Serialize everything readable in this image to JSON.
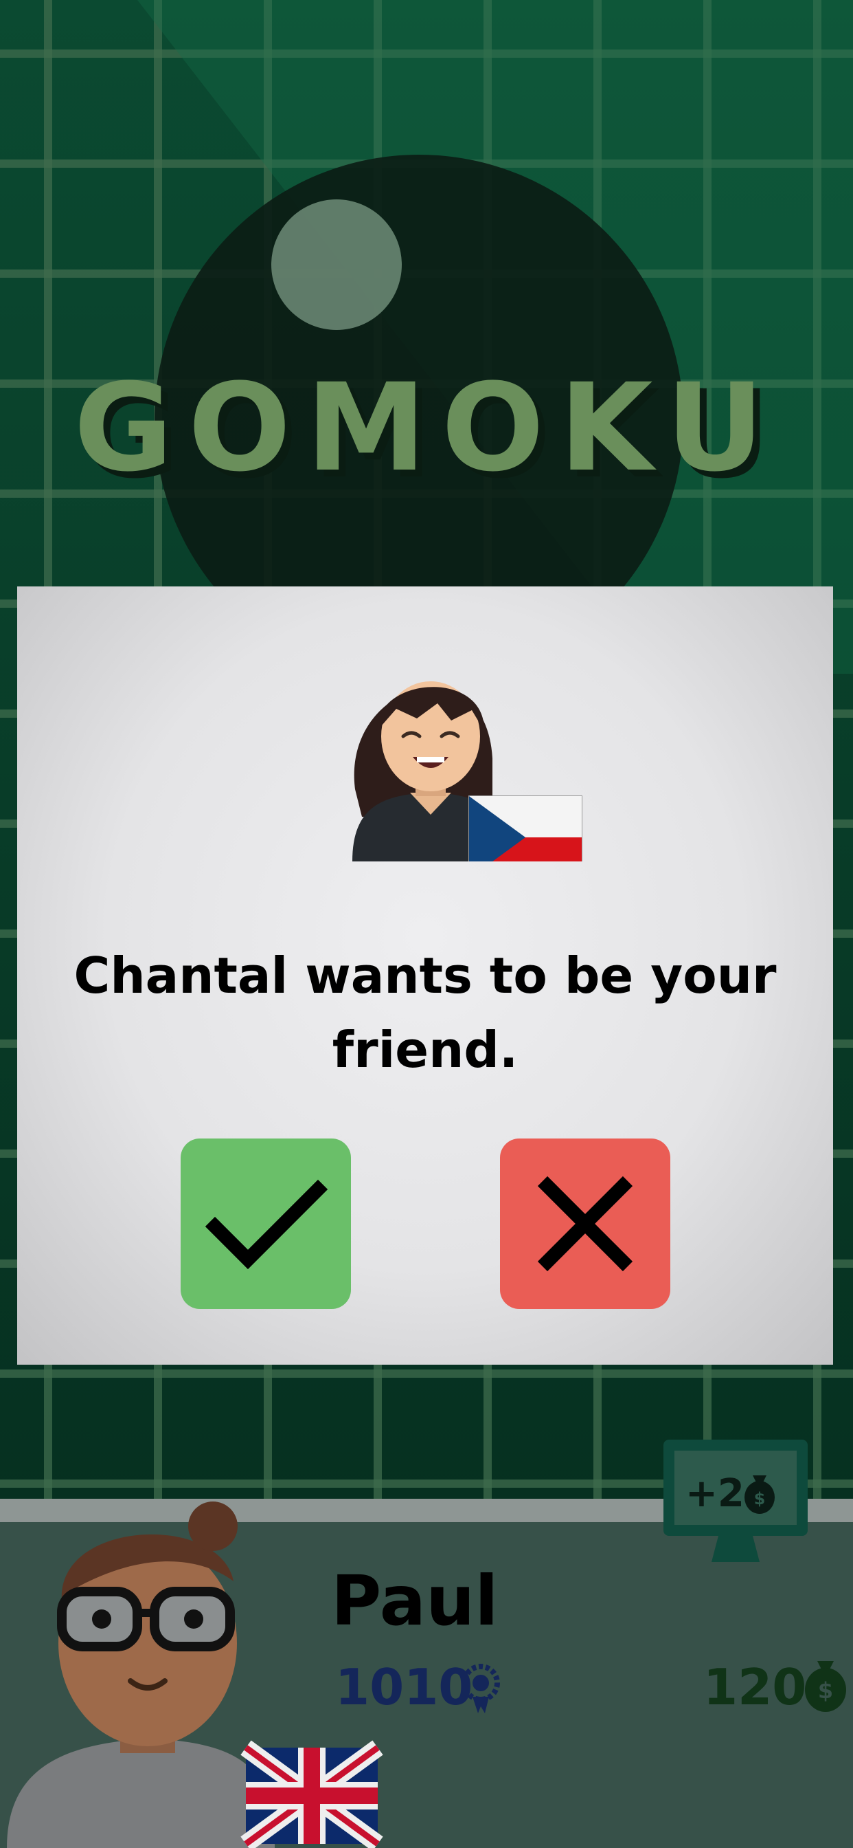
{
  "app": {
    "title": "GOMOKU"
  },
  "friend_request": {
    "message": "Chantal wants to be your friend.",
    "requester_flag": "czech-flag",
    "accept_icon": "checkmark-icon",
    "decline_icon": "close-icon"
  },
  "player": {
    "name": "Paul",
    "rating": "1010",
    "coins": "120",
    "flag": "uk-flag"
  },
  "bonus": {
    "label": "+2"
  },
  "colors": {
    "accept": "#6abf69",
    "decline": "#ea5d55",
    "title": "#6a8f5b",
    "background": "#063a26"
  }
}
